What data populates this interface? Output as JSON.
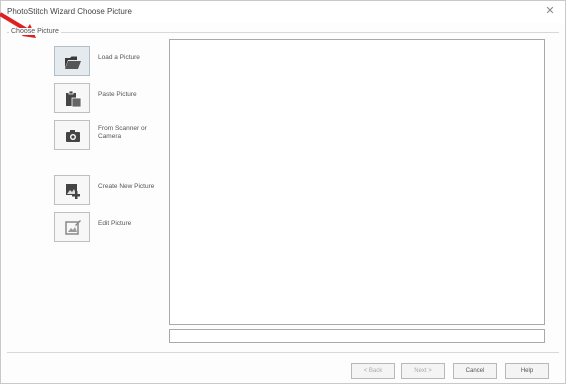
{
  "window": {
    "title": "PhotoStitch Wizard  Choose Picture",
    "close_glyph": "✕"
  },
  "section": {
    "label": "Choose Picture"
  },
  "options": [
    {
      "label": "Load a Picture",
      "icon": "folder-open-icon",
      "active": true
    },
    {
      "label": "Paste Picture",
      "icon": "paste-icon",
      "active": false
    },
    {
      "label": "From Scanner or Camera",
      "icon": "camera-icon",
      "active": false
    },
    {
      "label": "Create New Picture",
      "icon": "new-picture-icon",
      "active": false
    },
    {
      "label": "Edit Picture",
      "icon": "edit-picture-icon",
      "active": false
    }
  ],
  "buttons": {
    "back": "< Back",
    "next": "Next >",
    "cancel": "Cancel",
    "help": "Help"
  },
  "colors": {
    "annotation_arrow": "#e02020",
    "active_option_bg": "#e4eaee"
  }
}
